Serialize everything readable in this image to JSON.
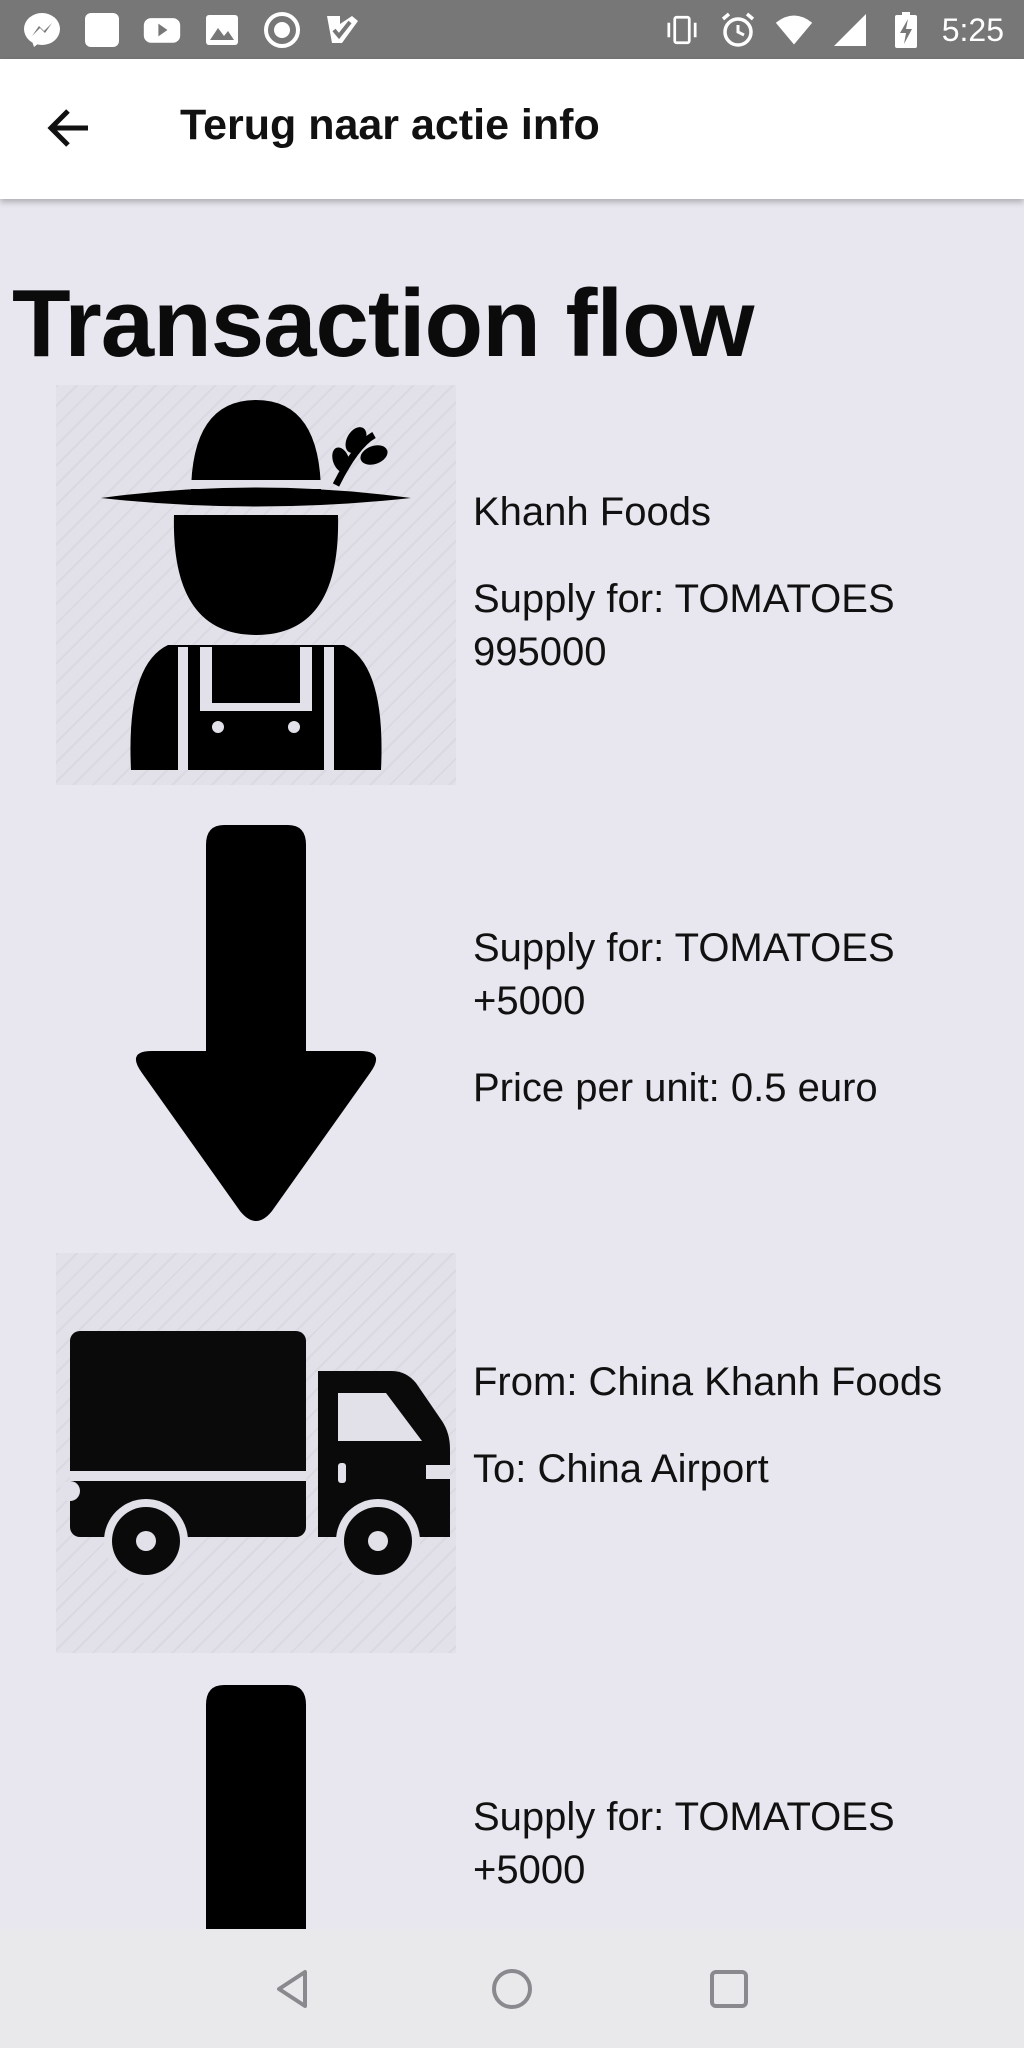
{
  "status_bar": {
    "time": "5:25",
    "left_icons": [
      "messenger-icon",
      "square-app-icon",
      "youtube-icon",
      "gallery-icon",
      "record-icon",
      "checkmark-app-icon"
    ],
    "right_icons": [
      "vibrate-icon",
      "alarm-icon",
      "wifi-icon",
      "signal-icon",
      "battery-charging-icon"
    ]
  },
  "app_bar": {
    "back_icon": "arrow-left-icon",
    "title": "Terug naar actie info"
  },
  "page": {
    "title": "Transaction flow"
  },
  "flow": [
    {
      "icon": "farmer-icon",
      "lines": [
        "Khanh Foods",
        "Supply for: TOMATOES 995000"
      ]
    },
    {
      "icon": "arrow-down-icon",
      "lines": [
        "Supply for: TOMATOES +5000",
        "Price per unit: 0.5 euro"
      ]
    },
    {
      "icon": "truck-icon",
      "lines": [
        "From: China Khanh Foods",
        "To: China Airport"
      ]
    },
    {
      "icon": "arrow-down-icon",
      "lines": [
        "Supply for: TOMATOES +5000"
      ]
    }
  ],
  "nav_bar": {
    "icons": [
      "back-triangle-icon",
      "home-circle-icon",
      "recents-square-icon"
    ]
  }
}
